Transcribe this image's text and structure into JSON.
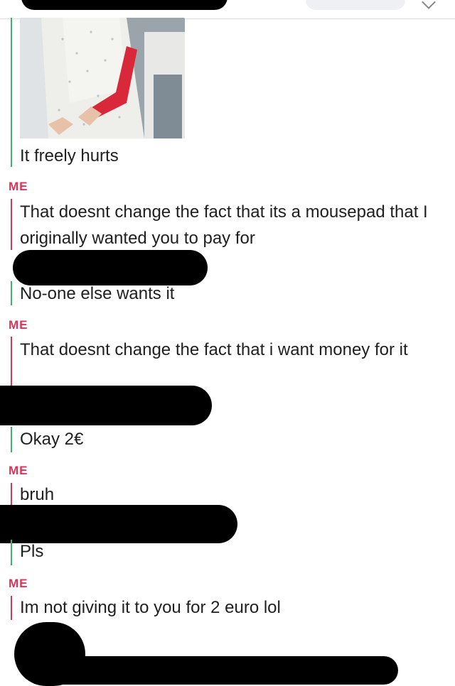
{
  "messages": [
    {
      "sender": "",
      "text": "It freely hurts"
    },
    {
      "sender": "ME",
      "text": "That doesnt change the fact that its a mousepad that I originally wanted you to pay for"
    },
    {
      "sender": "",
      "text": "No-one else  wants it"
    },
    {
      "sender": "ME",
      "text": "That doesnt change the fact that i want money for it"
    },
    {
      "sender": "",
      "text": "Okay 2€"
    },
    {
      "sender": "ME",
      "text": "bruh"
    },
    {
      "sender": "",
      "text": "Pls"
    },
    {
      "sender": "ME",
      "text": "Im not giving it to you for 2 euro lol"
    }
  ],
  "colors": {
    "me_accent": "#d9345a",
    "friend_accent": "#3cb371",
    "redaction": "#000000"
  },
  "icons": [
    "top-action-icon"
  ]
}
